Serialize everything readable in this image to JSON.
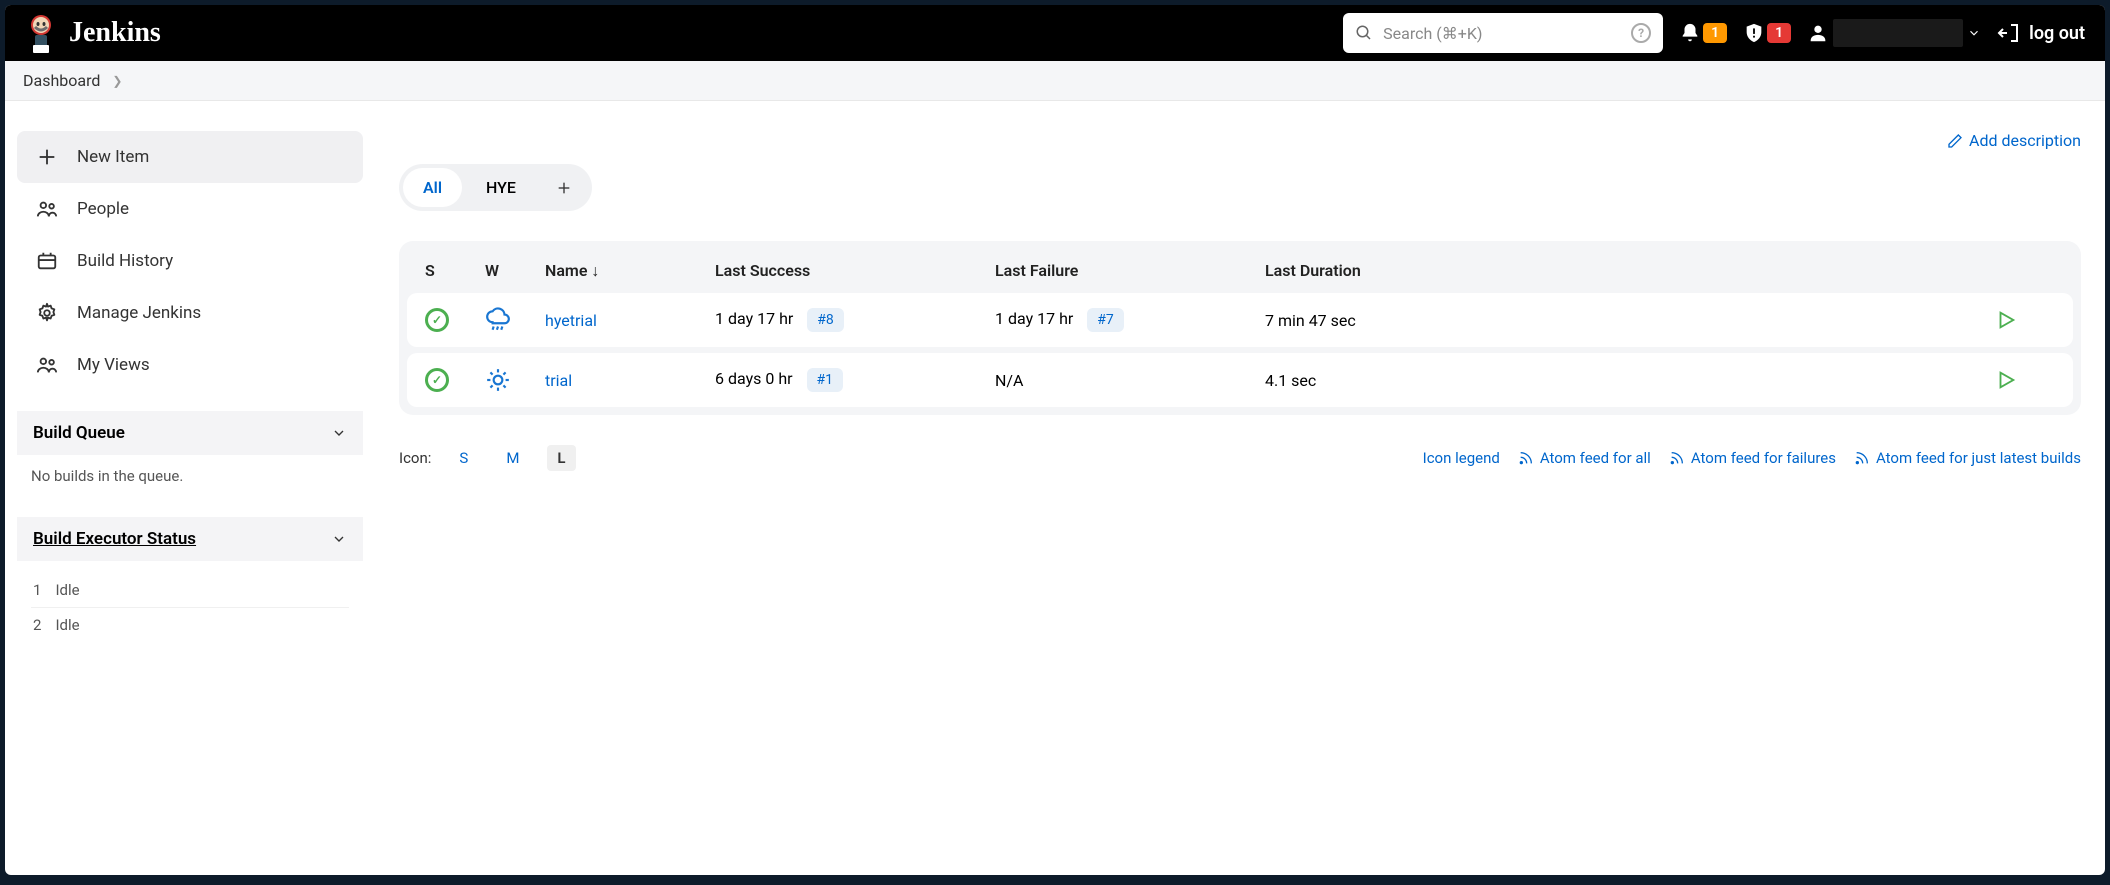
{
  "header": {
    "brand": "Jenkins",
    "search_placeholder": "Search (⌘+K)",
    "notif_count": "1",
    "alert_count": "1",
    "logout_label": "log out"
  },
  "breadcrumb": {
    "items": [
      "Dashboard"
    ]
  },
  "sidebar": {
    "nav": [
      {
        "label": "New Item"
      },
      {
        "label": "People"
      },
      {
        "label": "Build History"
      },
      {
        "label": "Manage Jenkins"
      },
      {
        "label": "My Views"
      }
    ],
    "build_queue": {
      "title": "Build Queue",
      "empty_msg": "No builds in the queue."
    },
    "executors": {
      "title": "Build Executor Status",
      "rows": [
        {
          "num": "1",
          "status": "Idle"
        },
        {
          "num": "2",
          "status": "Idle"
        }
      ]
    }
  },
  "main": {
    "add_description": "Add description",
    "tabs": [
      {
        "label": "All",
        "active": true
      },
      {
        "label": "HYE",
        "active": false
      }
    ],
    "table": {
      "headers": {
        "status": "S",
        "weather": "W",
        "name": "Name  ↓",
        "last_success": "Last Success",
        "last_failure": "Last Failure",
        "last_duration": "Last Duration"
      },
      "rows": [
        {
          "name": "hyetrial",
          "weather": "rain",
          "last_success_time": "1 day 17 hr",
          "last_success_build": "#8",
          "last_failure_time": "1 day 17 hr",
          "last_failure_build": "#7",
          "duration": "7 min 47 sec"
        },
        {
          "name": "trial",
          "weather": "sun",
          "last_success_time": "6 days 0 hr",
          "last_success_build": "#1",
          "last_failure_time": "N/A",
          "last_failure_build": "",
          "duration": "4.1 sec"
        }
      ]
    },
    "footer": {
      "icon_label": "Icon:",
      "sizes": [
        "S",
        "M",
        "L"
      ],
      "active_size": "L",
      "links": [
        "Icon legend",
        "Atom feed for all",
        "Atom feed for failures",
        "Atom feed for just latest builds"
      ]
    }
  }
}
